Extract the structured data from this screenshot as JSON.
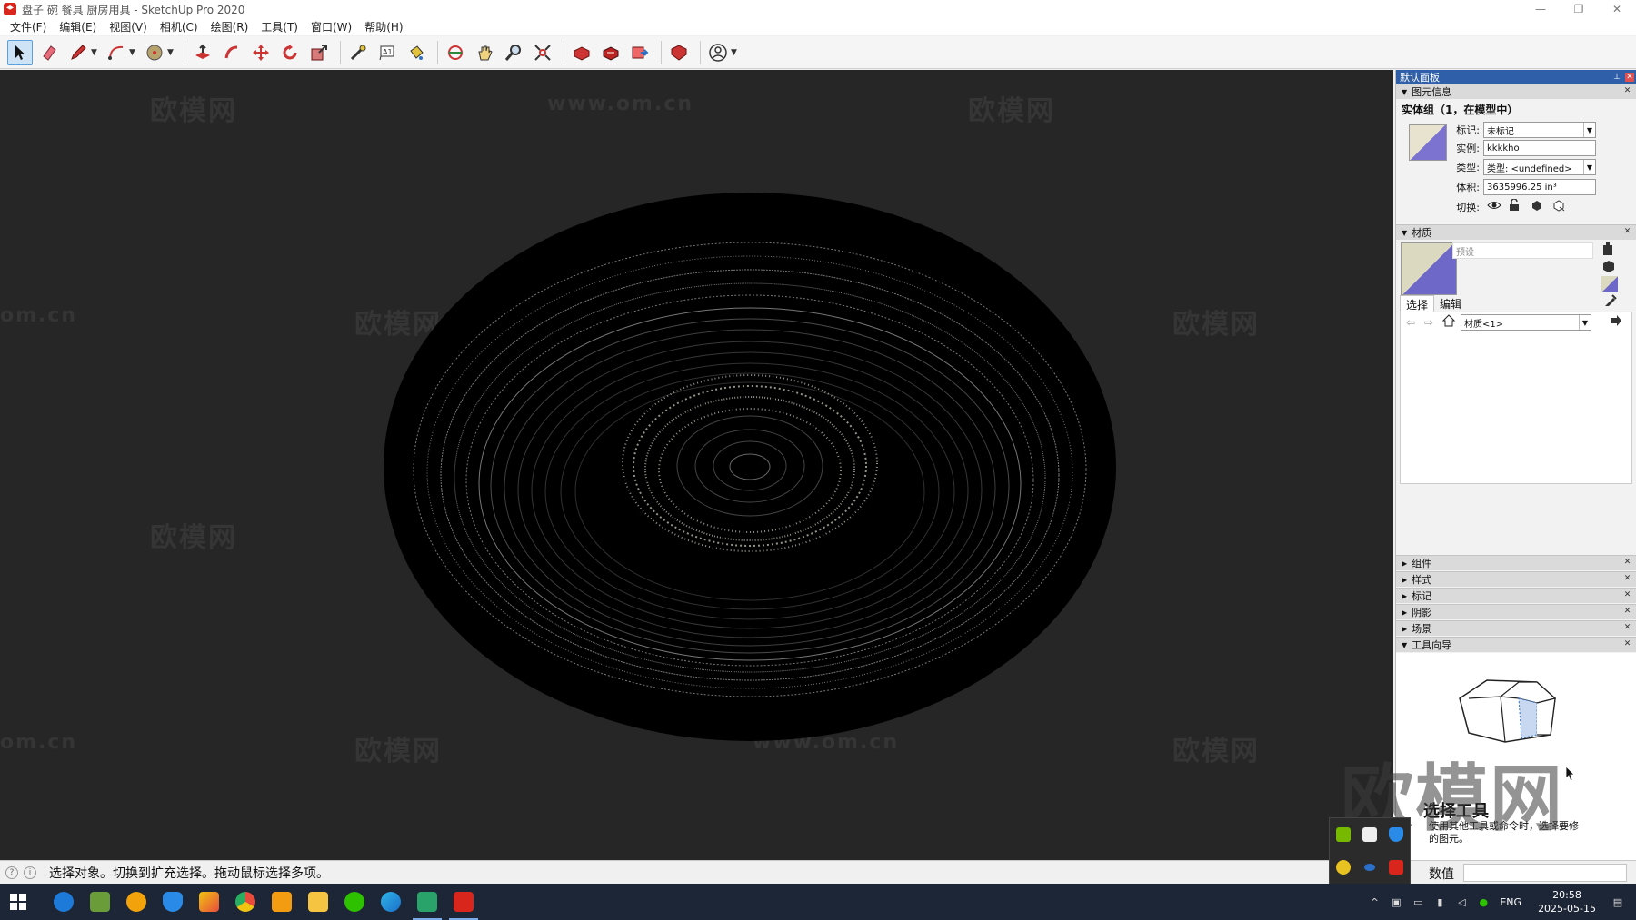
{
  "window": {
    "title": "盘子 碗 餐具 厨房用具 - SketchUp Pro 2020",
    "minimize": "—",
    "restore": "❐",
    "close": "✕"
  },
  "menu": [
    "文件(F)",
    "编辑(E)",
    "视图(V)",
    "相机(C)",
    "绘图(R)",
    "工具(T)",
    "窗口(W)",
    "帮助(H)"
  ],
  "toolbar": {
    "tools": [
      "select-tool",
      "eraser-tool",
      "line-tool",
      "arc-tool",
      "shapes-tool",
      "push-pull-tool",
      "offset-tool",
      "move-tool",
      "rotate-tool",
      "scale-tool",
      "tape-measure-tool",
      "text-tool",
      "paint-bucket-tool",
      "orbit-tool",
      "pan-tool",
      "zoom-tool",
      "zoom-extents-tool",
      "3d-warehouse",
      "extension-warehouse",
      "send-to-layout",
      "extension-manager",
      "account"
    ]
  },
  "viewport": {
    "background": "#262626",
    "watermarks": [
      "欧模网",
      "www.om.cn",
      "欧模网",
      "om.cn"
    ]
  },
  "panel": {
    "title": "默认面板",
    "entity_info": {
      "header": "图元信息",
      "title": "实体组（1，在模型中）",
      "tag_label": "标记:",
      "tag_value": "未标记",
      "instance_label": "实例:",
      "instance_value": "kkkkho",
      "type_label": "类型:",
      "type_value": "类型: <undefined>",
      "volume_label": "体积:",
      "volume_value": "3635996.25 in³",
      "toggle_label": "切换:"
    },
    "materials": {
      "header": "材质",
      "name_placeholder": "预设",
      "tab_select": "选择",
      "tab_edit": "编辑",
      "collection": "材质<1>"
    },
    "collapsed_sections": [
      "组件",
      "样式",
      "标记",
      "阴影",
      "场景"
    ],
    "instructor": {
      "header": "工具向导",
      "title": "选择工具",
      "desc_line1": "使用其他工具或命令时，选择要修",
      "desc_line2": "的图元。"
    }
  },
  "status": {
    "text": "选择对象。切换到扩充选择。拖动鼠标选择多项。",
    "measurements_label": "数值"
  },
  "taskbar": {
    "apps": [
      "start",
      "ie",
      "minecraft",
      "player",
      "security",
      "store",
      "chrome",
      "app-orange",
      "explorer",
      "wechat",
      "edge",
      "app-3",
      "sketchup"
    ],
    "lang": "ENG",
    "time": "20:58",
    "date": "2025-05-15"
  },
  "big_watermark": "欧模网"
}
